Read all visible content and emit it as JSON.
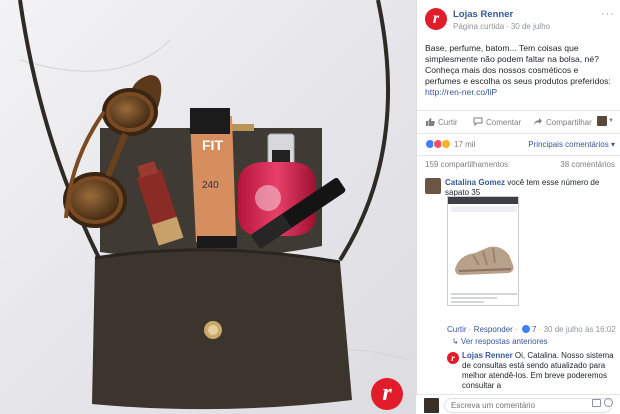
{
  "post": {
    "page_name": "Lojas Renner",
    "page_type": "Página curtida",
    "separator": "·",
    "date": "30 de julho",
    "options_icon": "···",
    "text_main": "Base, perfume, batom... Tem coisas que simplesmente não podem faltar na bolsa, né? Conheça mais dos nossos cosméticos e perfumes e escolha os seus produtos preferidos: ",
    "text_link": "http://ren-ner.co/liP",
    "logo_letter": "r"
  },
  "actions": {
    "like": "Curtir",
    "comment": "Comentar",
    "share": "Compartilhar",
    "like_icon": "thumbs-up-icon",
    "comment_icon": "speech-bubble-icon",
    "share_icon": "share-arrow-icon"
  },
  "reactions": {
    "count": "17 mil",
    "sort_label": "Principais comentários ▾"
  },
  "stats": {
    "shares": "159 compartilhamentos",
    "comments": "38 comentários"
  },
  "comment": {
    "author": "Catalina Gomez",
    "text": "você tem esse número de sapato 35",
    "like_label": "Curtir",
    "reply_label": "Responder",
    "likes": "7",
    "date": "30 de julho às 16:02",
    "more_replies": "↳ Ver respostas anteriores",
    "sep": "·"
  },
  "reply": {
    "author": "Lojas Renner",
    "text": "Oi, Catalina. Nosso sistema de consultas está sendo atualizado para melhor atendê-los. Em breve poderemos consultar a"
  },
  "composer": {
    "placeholder": "Escreva um comentário"
  },
  "colors": {
    "brand_red": "#e11d2c",
    "facebook_blue": "#365899",
    "bag_color": "#3b352e"
  }
}
